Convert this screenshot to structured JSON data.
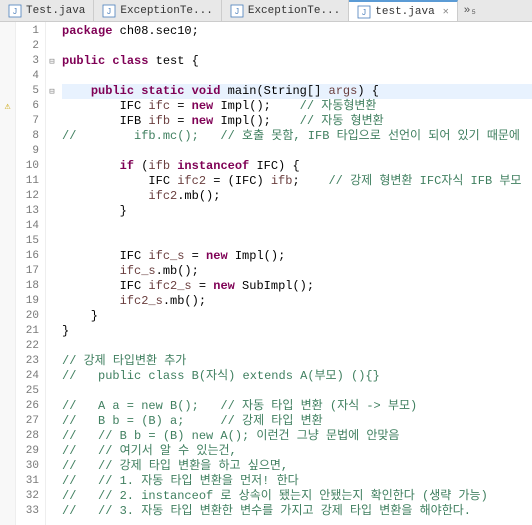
{
  "tabs": [
    {
      "label": "Test.java",
      "active": false,
      "close": false
    },
    {
      "label": "ExceptionTe...",
      "active": false,
      "close": false
    },
    {
      "label": "ExceptionTe...",
      "active": false,
      "close": false
    },
    {
      "label": "test.java",
      "active": true,
      "close": true
    }
  ],
  "overflow": "»₅",
  "lines": [
    {
      "n": "1",
      "fold": "",
      "mark": "",
      "tokens": [
        [
          "kw",
          "package"
        ],
        [
          "",
          " ch08.sec10;"
        ]
      ]
    },
    {
      "n": "2",
      "fold": "",
      "mark": "",
      "tokens": [
        [
          "",
          ""
        ]
      ]
    },
    {
      "n": "3",
      "fold": "-",
      "mark": "",
      "tokens": [
        [
          "kw",
          "public"
        ],
        [
          "",
          " "
        ],
        [
          "kw",
          "class"
        ],
        [
          "",
          " test {"
        ]
      ]
    },
    {
      "n": "4",
      "fold": "",
      "mark": "",
      "tokens": [
        [
          "",
          ""
        ]
      ]
    },
    {
      "n": "5",
      "fold": "-",
      "mark": "",
      "hl": true,
      "tokens": [
        [
          "",
          "    "
        ],
        [
          "kw",
          "public"
        ],
        [
          "",
          " "
        ],
        [
          "kw",
          "static"
        ],
        [
          "",
          " "
        ],
        [
          "kw",
          "void"
        ],
        [
          "",
          " main(String[] "
        ],
        [
          "arg",
          "args"
        ],
        [
          "",
          ") {"
        ]
      ]
    },
    {
      "n": "6",
      "fold": "",
      "mark": "warn",
      "tokens": [
        [
          "",
          "        IFC "
        ],
        [
          "var",
          "ifc"
        ],
        [
          "",
          " = "
        ],
        [
          "kw",
          "new"
        ],
        [
          "",
          " Impl();    "
        ],
        [
          "cmt",
          "// 자동형변환"
        ]
      ]
    },
    {
      "n": "7",
      "fold": "",
      "mark": "",
      "tokens": [
        [
          "",
          "        IFB "
        ],
        [
          "var",
          "ifb"
        ],
        [
          "",
          " = "
        ],
        [
          "kw",
          "new"
        ],
        [
          "",
          " Impl();    "
        ],
        [
          "cmt",
          "// 자동 형변환"
        ]
      ]
    },
    {
      "n": "8",
      "fold": "",
      "mark": "",
      "tokens": [
        [
          "cmt",
          "//        ifb.mc();   // 호출 못함, IFB 타입으로 선언이 되어 있기 때문에"
        ]
      ]
    },
    {
      "n": "9",
      "fold": "",
      "mark": "",
      "tokens": [
        [
          "",
          ""
        ]
      ]
    },
    {
      "n": "10",
      "fold": "",
      "mark": "",
      "tokens": [
        [
          "",
          "        "
        ],
        [
          "kw",
          "if"
        ],
        [
          "",
          " ("
        ],
        [
          "var",
          "ifb"
        ],
        [
          "",
          " "
        ],
        [
          "kw",
          "instanceof"
        ],
        [
          "",
          " IFC) {"
        ]
      ]
    },
    {
      "n": "11",
      "fold": "",
      "mark": "",
      "tokens": [
        [
          "",
          "            IFC "
        ],
        [
          "var",
          "ifc2"
        ],
        [
          "",
          " = (IFC) "
        ],
        [
          "var",
          "ifb"
        ],
        [
          "",
          ";    "
        ],
        [
          "cmt",
          "// 강제 형변환 IFC자식 IFB 부모"
        ]
      ]
    },
    {
      "n": "12",
      "fold": "",
      "mark": "",
      "tokens": [
        [
          "",
          "            "
        ],
        [
          "var",
          "ifc2"
        ],
        [
          "",
          ".mb();"
        ]
      ]
    },
    {
      "n": "13",
      "fold": "",
      "mark": "",
      "tokens": [
        [
          "",
          "        }"
        ]
      ]
    },
    {
      "n": "14",
      "fold": "",
      "mark": "",
      "tokens": [
        [
          "",
          ""
        ]
      ]
    },
    {
      "n": "15",
      "fold": "",
      "mark": "",
      "tokens": [
        [
          "",
          ""
        ]
      ]
    },
    {
      "n": "16",
      "fold": "",
      "mark": "",
      "tokens": [
        [
          "",
          "        IFC "
        ],
        [
          "var",
          "ifc_s"
        ],
        [
          "",
          " = "
        ],
        [
          "kw",
          "new"
        ],
        [
          "",
          " Impl();"
        ]
      ]
    },
    {
      "n": "17",
      "fold": "",
      "mark": "",
      "tokens": [
        [
          "",
          "        "
        ],
        [
          "var",
          "ifc_s"
        ],
        [
          "",
          ".mb();"
        ]
      ]
    },
    {
      "n": "18",
      "fold": "",
      "mark": "",
      "tokens": [
        [
          "",
          "        IFC "
        ],
        [
          "var",
          "ifc2_s"
        ],
        [
          "",
          " = "
        ],
        [
          "kw",
          "new"
        ],
        [
          "",
          " SubImpl();"
        ]
      ]
    },
    {
      "n": "19",
      "fold": "",
      "mark": "",
      "tokens": [
        [
          "",
          "        "
        ],
        [
          "var",
          "ifc2_s"
        ],
        [
          "",
          ".mb();"
        ]
      ]
    },
    {
      "n": "20",
      "fold": "",
      "mark": "",
      "tokens": [
        [
          "",
          "    }"
        ]
      ]
    },
    {
      "n": "21",
      "fold": "",
      "mark": "",
      "tokens": [
        [
          "",
          "}"
        ]
      ]
    },
    {
      "n": "22",
      "fold": "",
      "mark": "",
      "tokens": [
        [
          "",
          ""
        ]
      ]
    },
    {
      "n": "23",
      "fold": "",
      "mark": "",
      "tokens": [
        [
          "cmt",
          "// 강제 타입변환 추가"
        ]
      ]
    },
    {
      "n": "24",
      "fold": "",
      "mark": "",
      "tokens": [
        [
          "cmt",
          "//   public class B(자식) extends A(부모) (){}"
        ]
      ]
    },
    {
      "n": "25",
      "fold": "",
      "mark": "",
      "tokens": [
        [
          "",
          ""
        ]
      ]
    },
    {
      "n": "26",
      "fold": "",
      "mark": "",
      "tokens": [
        [
          "cmt",
          "//   A a = new B();   // 자동 타입 변환 (자식 -> 부모)"
        ]
      ]
    },
    {
      "n": "27",
      "fold": "",
      "mark": "",
      "tokens": [
        [
          "cmt",
          "//   B b = (B) a;     // 강제 타입 변환"
        ]
      ]
    },
    {
      "n": "28",
      "fold": "",
      "mark": "",
      "tokens": [
        [
          "cmt",
          "//   // B b = (B) new A(); 이런건 그냥 문법에 안맞음"
        ]
      ]
    },
    {
      "n": "29",
      "fold": "",
      "mark": "",
      "tokens": [
        [
          "cmt",
          "//   // 여기서 알 수 있는건,"
        ]
      ]
    },
    {
      "n": "30",
      "fold": "",
      "mark": "",
      "tokens": [
        [
          "cmt",
          "//   // 강제 타입 변환을 하고 싶으면,"
        ]
      ]
    },
    {
      "n": "31",
      "fold": "",
      "mark": "",
      "tokens": [
        [
          "cmt",
          "//   // 1. 자동 타입 변환을 먼저! 한다"
        ]
      ]
    },
    {
      "n": "32",
      "fold": "",
      "mark": "",
      "tokens": [
        [
          "cmt",
          "//   // 2. instanceof 로 상속이 됐는지 안됐는지 확인한다 (생략 가능)"
        ]
      ]
    },
    {
      "n": "33",
      "fold": "",
      "mark": "",
      "tokens": [
        [
          "cmt",
          "//   // 3. 자동 타입 변환한 변수를 가지고 강제 타입 변환을 해야한다."
        ]
      ]
    }
  ]
}
